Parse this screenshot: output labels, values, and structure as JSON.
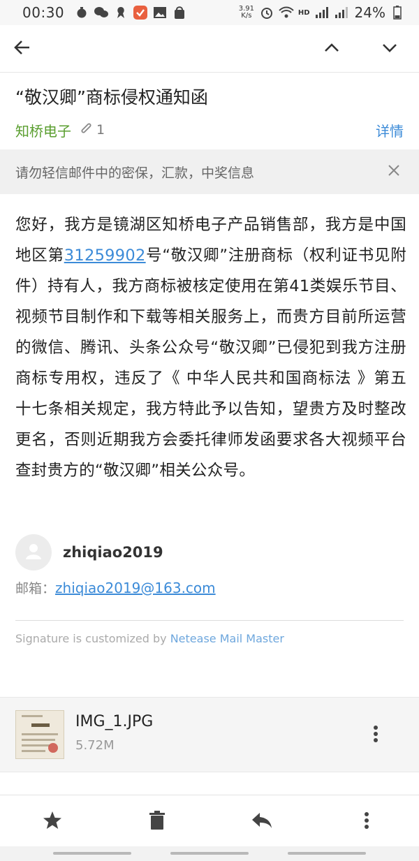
{
  "status_bar": {
    "time": "00:30",
    "net_speed": "3.91\nK/s",
    "signal_label": "HD",
    "net_4g": "4G",
    "net_2g": "2G",
    "battery": "24%"
  },
  "toolbar": {
    "back_icon": "arrow-left-icon",
    "prev_icon": "chevron-up-icon",
    "next_icon": "chevron-down-icon"
  },
  "mail": {
    "subject": "“敬汉卿”商标侵权通知函",
    "sender": "知桥电子",
    "attachment_count": "1",
    "details_label": "详情",
    "warning": "请勿轻信邮件中的密保，汇款，中奖信息",
    "body_before_link": "您好，我方是镜湖区知桥电子产品销售部，我方是中国地区第",
    "body_link": "31259902",
    "body_after_link": "号“敬汉卿”注册商标（权利证书见附件）持有人，我方商标被核定使用在第41类娱乐节目、视频节目制作和下载等相关服务上，而贵方目前所运营的微信、腾讯、头条公众号“敬汉卿”已侵犯到我方注册商标专用权，违反了《 中华人民共和国商标法 》第五十七条相关规定，我方特此予以告知，望贵方及时整改更名，否则近期我方会委托律师发函要求各大视频平台查封贵方的“敬汉卿”相关公众号。"
  },
  "signature": {
    "name": "zhiqiao2019",
    "email_label": "邮箱：",
    "email": "zhiqiao2019@163.com",
    "footer_prefix": "Signature is customized by ",
    "footer_brand": "Netease Mail Master"
  },
  "attachment": {
    "filename": "IMG_1.JPG",
    "size": "5.72M"
  },
  "bottom_actions": {
    "star_icon": "star-icon",
    "delete_icon": "trash-icon",
    "reply_icon": "reply-icon",
    "more_icon": "more-vertical-icon"
  },
  "colors": {
    "sender_green": "#5a9e2f",
    "link_blue": "#3c8bd8"
  }
}
